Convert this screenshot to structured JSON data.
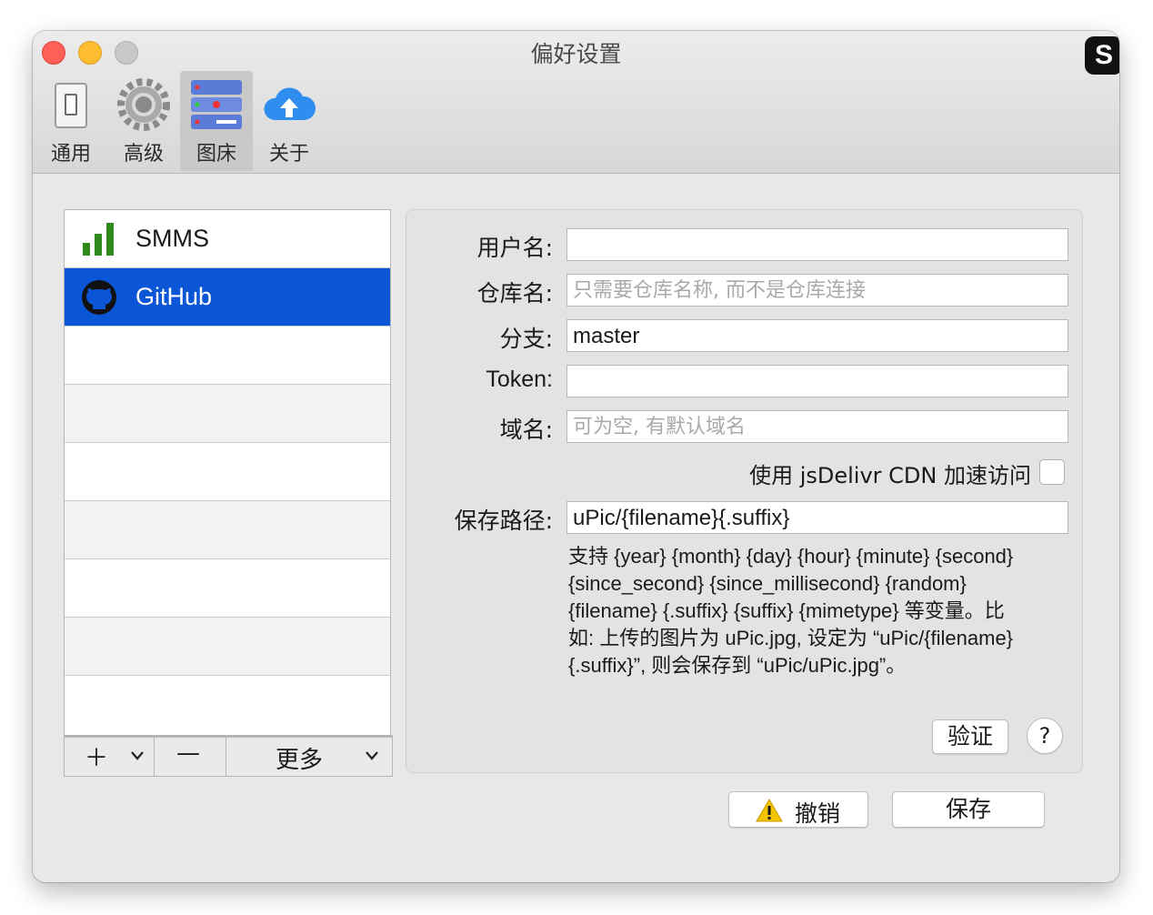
{
  "window": {
    "title": "偏好设置"
  },
  "toolbar": {
    "tabs": [
      {
        "label": "通用",
        "icon": "switch-icon"
      },
      {
        "label": "高级",
        "icon": "gear-icon"
      },
      {
        "label": "图床",
        "icon": "server-rack-icon",
        "selected": true
      },
      {
        "label": "关于",
        "icon": "cloud-upload-icon"
      }
    ]
  },
  "hosts": {
    "items": [
      {
        "label": "SMMS",
        "icon": "signal-bars-icon"
      },
      {
        "label": "GitHub",
        "icon": "github-icon",
        "selected": true
      }
    ],
    "add_label": "＋",
    "remove_label": "—",
    "more_label": "更多"
  },
  "form": {
    "username_label": "用户名:",
    "username_value": "",
    "repo_label": "仓库名:",
    "repo_placeholder": "只需要仓库名称, 而不是仓库连接",
    "branch_label": "分支:",
    "branch_value": "master",
    "token_label": "Token:",
    "token_value": "",
    "domain_label": "域名:",
    "domain_placeholder": "可为空, 有默认域名",
    "cdn_label": "使用 jsDelivr CDN 加速访问",
    "cdn_checked": false,
    "path_label": "保存路径:",
    "path_value": "uPic/{filename}{.suffix}",
    "help_lines": [
      "支持 {year} {month} {day} {hour} {minute} {second}",
      "{since_second} {since_millisecond} {random}",
      "{filename} {.suffix} {suffix} {mimetype} 等变量。比",
      "如: 上传的图片为 uPic.jpg, 设定为 “uPic/{filename}",
      "{.suffix}”, 则会保存到 “uPic/uPic.jpg”。"
    ],
    "verify_label": "验证",
    "help_button": "?"
  },
  "footer": {
    "revert_label": "撤销",
    "save_label": "保存"
  },
  "colors": {
    "selection": "#0b56d6",
    "close": "#fe5f57",
    "minimize": "#febc2e",
    "warning": "#f5c400"
  }
}
